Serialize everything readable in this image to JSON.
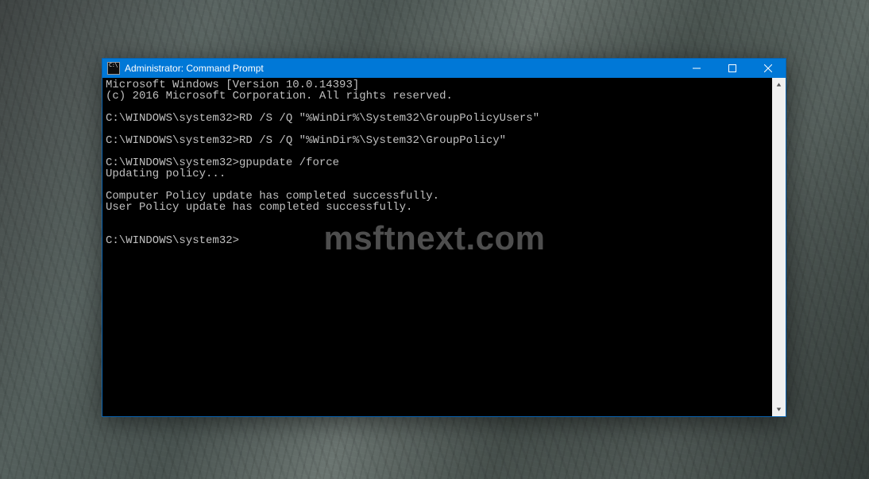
{
  "window": {
    "title": "Administrator: Command Prompt"
  },
  "terminal": {
    "lines": [
      "Microsoft Windows [Version 10.0.14393]",
      "(c) 2016 Microsoft Corporation. All rights reserved.",
      "",
      "C:\\WINDOWS\\system32>RD /S /Q \"%WinDir%\\System32\\GroupPolicyUsers\"",
      "",
      "C:\\WINDOWS\\system32>RD /S /Q \"%WinDir%\\System32\\GroupPolicy\"",
      "",
      "C:\\WINDOWS\\system32>gpupdate /force",
      "Updating policy...",
      "",
      "Computer Policy update has completed successfully.",
      "User Policy update has completed successfully.",
      "",
      "",
      "C:\\WINDOWS\\system32>"
    ]
  },
  "watermark": "msftnext.com"
}
